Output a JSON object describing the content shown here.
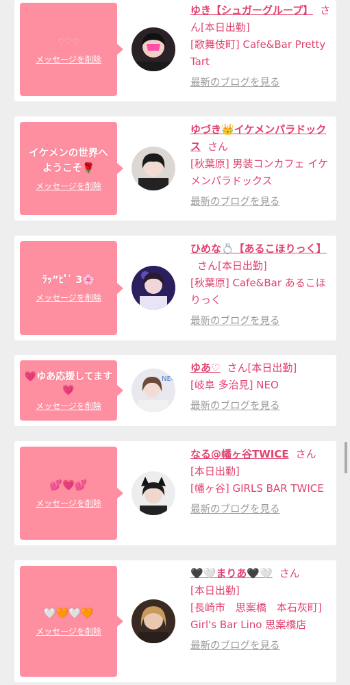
{
  "cards": [
    {
      "message": "♡♡♡",
      "delete_label": "メッセージを削除",
      "name": "ゆき【シュガーグループ】",
      "san": "さん",
      "tag": "[本日出勤]",
      "area": "[歌舞伎町]",
      "shop": "Cafe&Bar Pretty Tart",
      "blog": "最新のブログを見る"
    },
    {
      "message": "イケメンの世界へようこそ🌹",
      "delete_label": "メッセージを削除",
      "name": "ゆづき👑イケメンパラドックス",
      "san": "さん",
      "tag": "",
      "area": "[秋葉原]",
      "shop": "男装コンカフェ イケメンパラドックス",
      "blog": "最新のブログを見る"
    },
    {
      "message": "ﾗｯ”ﾋﾟ ͗ 3🌸",
      "delete_label": "メッセージを削除",
      "name": "ひめな💍【あるこほりっく】",
      "san": "さん",
      "tag": "[本日出勤]",
      "area": "[秋葉原]",
      "shop": "Cafe&Bar あるこほりっく",
      "blog": "最新のブログを見る"
    },
    {
      "message": "💗ゆあ応援してます💗",
      "delete_label": "メッセージを削除",
      "name": "ゆあ♡",
      "san": "さん",
      "tag": "[本日出勤]",
      "area": "[岐阜 多治見]",
      "shop": "NEO",
      "blog": "最新のブログを見る"
    },
    {
      "message": "💕💗💕",
      "delete_label": "メッセージを削除",
      "name": "なる@幡ヶ谷TWICE",
      "san": "さん",
      "tag": "[本日出勤]",
      "area": "[幡ヶ谷]",
      "shop": "GIRLS BAR TWICE",
      "blog": "最新のブログを見る"
    },
    {
      "message": "🤍🧡🤍🧡",
      "delete_label": "メッセージを削除",
      "name": "🖤🤍まりあ🖤🤍",
      "san": "さん",
      "tag": "[本日出勤]",
      "area": "[長崎市　思案橋　本石灰町]",
      "shop": "Girl's Bar Lino 思案橋店",
      "blog": "最新のブログを見る"
    }
  ],
  "colors": {
    "accent": "#e0436f",
    "bubble": "#fe8fa0",
    "link_gray": "#9a9a9a",
    "background": "#eeeeee"
  }
}
